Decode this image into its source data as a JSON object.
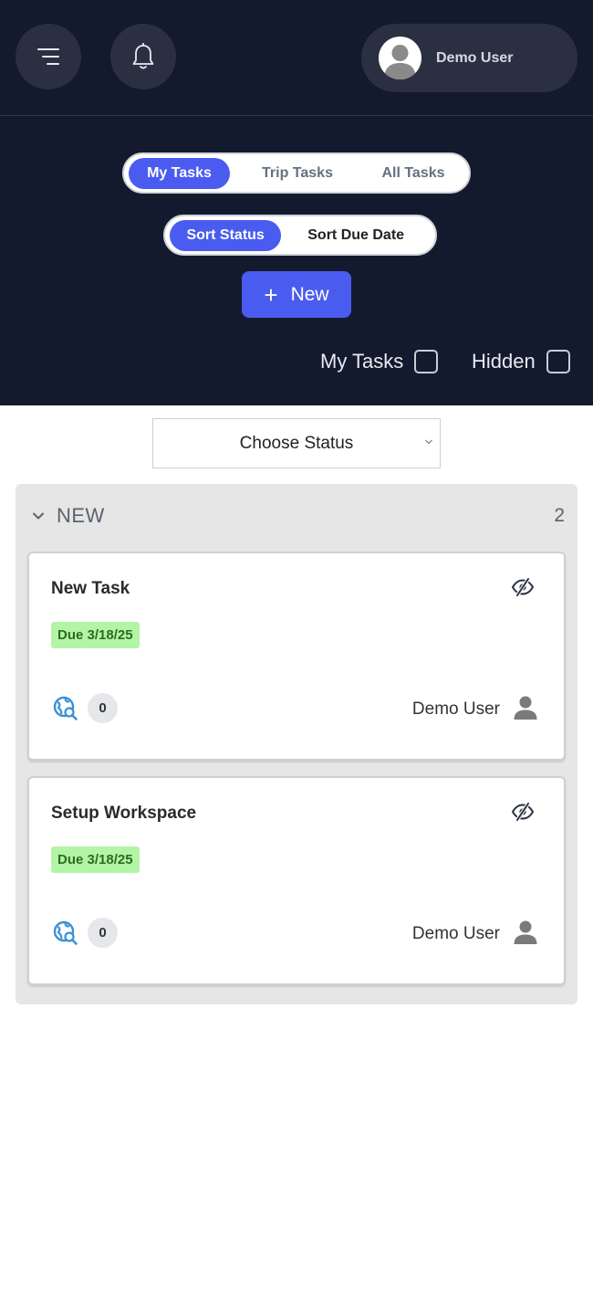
{
  "header": {
    "menu_icon": "menu-icon",
    "bell_icon": "bell-icon",
    "user": {
      "name": "Demo User",
      "avatar_icon": "avatar-icon"
    }
  },
  "task_scope_tabs": [
    {
      "label": "My Tasks",
      "active": true
    },
    {
      "label": "Trip Tasks",
      "active": false
    },
    {
      "label": "All Tasks",
      "active": false
    }
  ],
  "sort_tabs": [
    {
      "label": "Sort Status",
      "active": true
    },
    {
      "label": "Sort Due Date",
      "active": false
    }
  ],
  "new_button": {
    "label": "New"
  },
  "filters": {
    "my_tasks": {
      "label": "My Tasks",
      "checked": false
    },
    "hidden": {
      "label": "Hidden",
      "checked": false
    }
  },
  "status_select": {
    "selected": "Choose Status"
  },
  "groups": [
    {
      "title": "NEW",
      "count": "2",
      "tasks": [
        {
          "title": "New Task",
          "due": "Due 3/18/25",
          "comments": "0",
          "assignee": "Demo User"
        },
        {
          "title": "Setup Workspace",
          "due": "Due 3/18/25",
          "comments": "0",
          "assignee": "Demo User"
        }
      ]
    }
  ],
  "colors": {
    "header_bg": "#131a2e",
    "accent": "#4a5cf0",
    "due_badge_bg": "#b3f5a6",
    "group_bg": "#e6e6e6"
  }
}
